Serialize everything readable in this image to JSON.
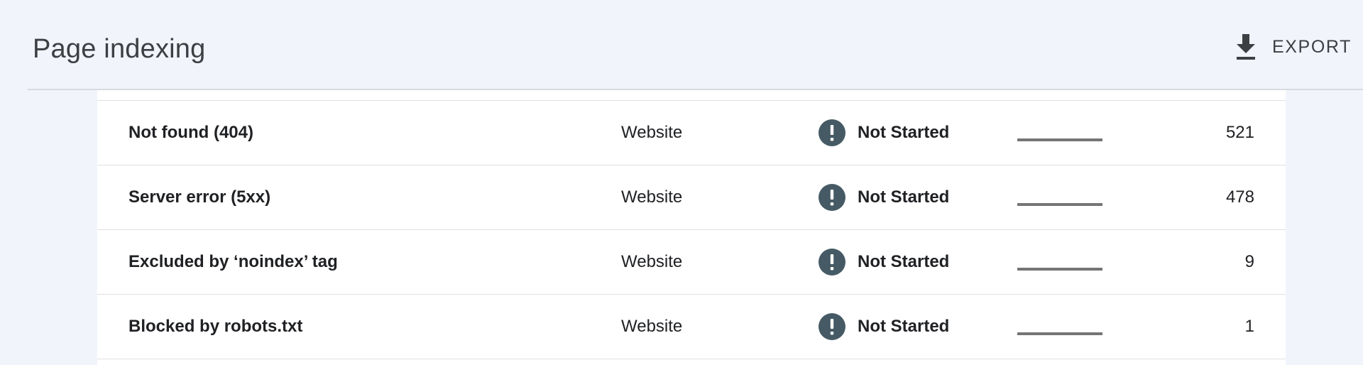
{
  "header": {
    "title": "Page indexing",
    "export_label": "EXPORT",
    "export_icon": "download-icon"
  },
  "colors": {
    "background": "#f1f4fb",
    "status_icon": "#455a64",
    "trend_line": "#757575",
    "divider": "#e0e0e0"
  },
  "table": {
    "rows": [
      {
        "reason": "Not found (404)",
        "source": "Website",
        "status_icon": "alert-icon",
        "status": "Not Started",
        "pages": "521"
      },
      {
        "reason": "Server error (5xx)",
        "source": "Website",
        "status_icon": "alert-icon",
        "status": "Not Started",
        "pages": "478"
      },
      {
        "reason": "Excluded by ‘noindex’ tag",
        "source": "Website",
        "status_icon": "alert-icon",
        "status": "Not Started",
        "pages": "9"
      },
      {
        "reason": "Blocked by robots.txt",
        "source": "Website",
        "status_icon": "alert-icon",
        "status": "Not Started",
        "pages": "1"
      }
    ]
  }
}
